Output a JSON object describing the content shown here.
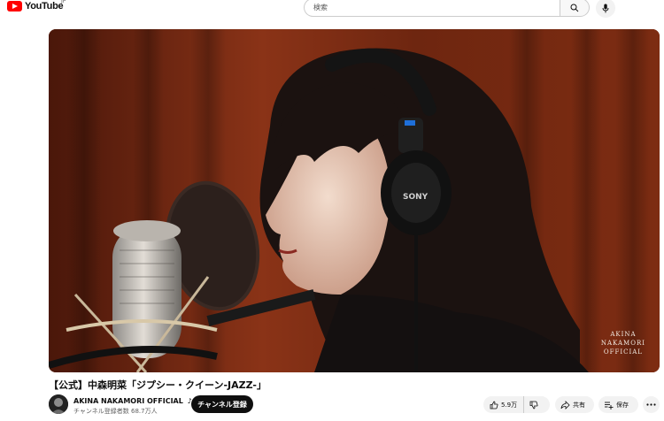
{
  "header": {
    "logo_text": "YouTube",
    "region": "JP",
    "search_placeholder": "検索"
  },
  "video": {
    "title": "【公式】中森明菜「ジプシー・クイーン-JAZZ-」",
    "watermark": [
      "AKINA",
      "NAKAMORI",
      "OFFICIAL"
    ]
  },
  "channel": {
    "name": "AKINA NAKAMORI OFFICIAL",
    "verified_icon": "music-note-icon",
    "subscribers": "チャンネル登録者数 68.7万人",
    "subscribe_label": "チャンネル登録"
  },
  "actions": {
    "like_count": "5.9万",
    "share_label": "共有",
    "save_label": "保存"
  },
  "colors": {
    "brand_red": "#ff0000",
    "curtain": "#7a2a14"
  }
}
